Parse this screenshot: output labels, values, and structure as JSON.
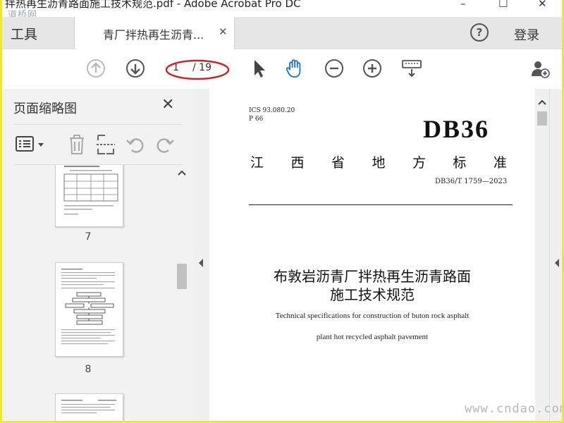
{
  "window": {
    "title": "拌热再生沥青路面施工技术规范.pdf - Adobe Acrobat Pro DC",
    "watermark": "道桥网",
    "minimize": "–",
    "maximize": "☐",
    "close": "✕"
  },
  "tabs": {
    "tools_label": "工具",
    "document_label": "青厂拌热再生沥青...",
    "close_label": "✕",
    "help_label": "?",
    "login_label": "登录"
  },
  "toolbar": {
    "current_page": "1",
    "total_pages": "/ 19",
    "annotation_color": "#d42020"
  },
  "sidebar": {
    "title": "页面缩略图",
    "close_label": "✕",
    "thumbnails": [
      {
        "page": "7"
      },
      {
        "page": "8"
      }
    ]
  },
  "document": {
    "ics": "ICS   93.080.20",
    "p_code": "P  66",
    "db_code": "DB36",
    "province": [
      "江",
      "西",
      "省",
      "地",
      "方",
      "标",
      "准"
    ],
    "std_no": "DB36/T 1759—2023",
    "title_line1": "布敦岩沥青厂拌热再生沥青路面",
    "title_line2": "施工技术规范",
    "en_line1": "Technical specifications for construction of buton rock asphalt",
    "en_line2": "plant hot recycled asphalt pavement"
  },
  "site_watermark": "www.cndao.com",
  "colors": {
    "frame_border": "#f0e82e",
    "accent_blue": "#1a73c9"
  }
}
